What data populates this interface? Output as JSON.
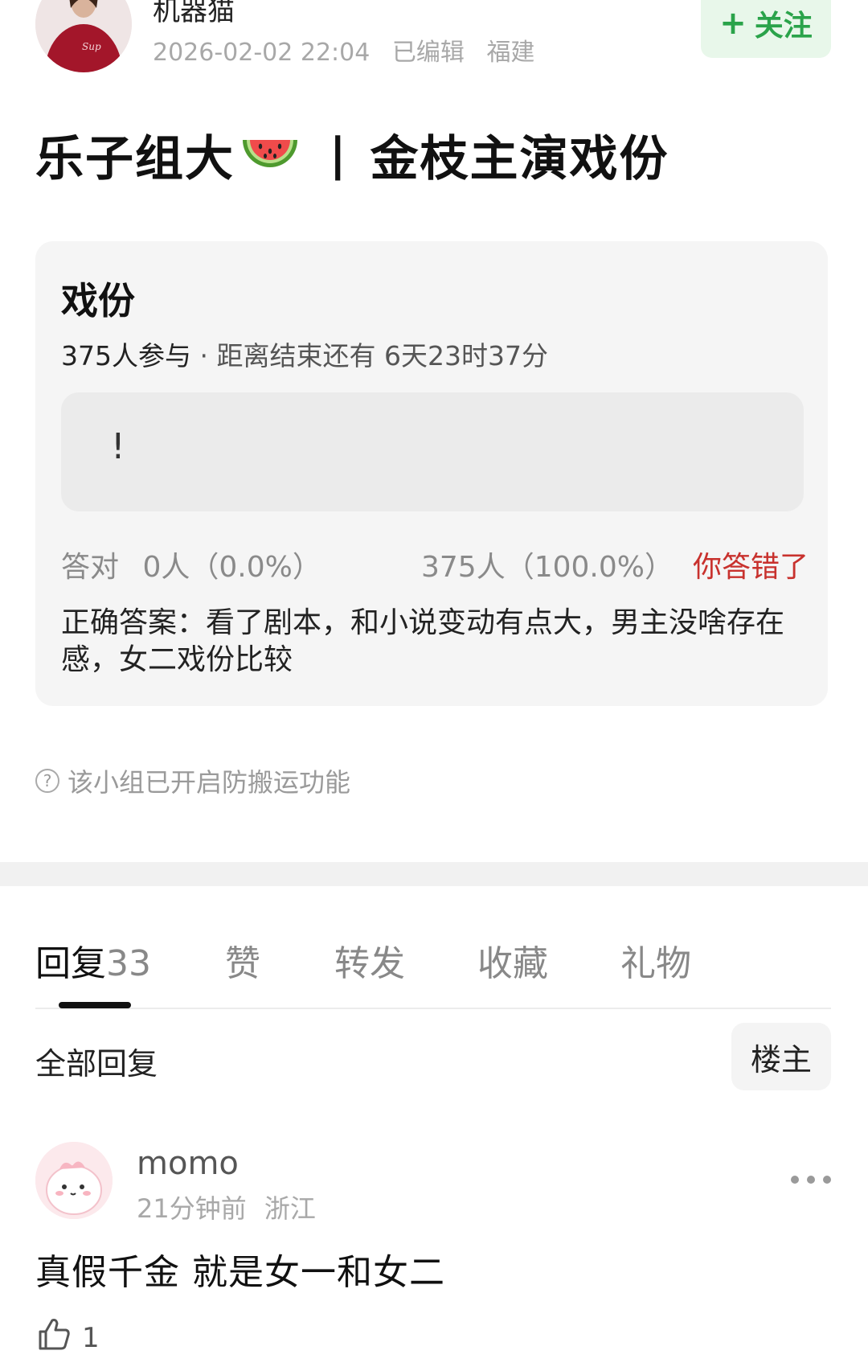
{
  "post": {
    "author": "机器猫",
    "date": "2026-02-02 22:04",
    "edited": "已编辑",
    "location": "福建",
    "follow_label": "关注",
    "title_part1": "乐子组大",
    "title_part2": "金枝主演戏份"
  },
  "quiz": {
    "title": "戏份",
    "participants": "375人参与",
    "separator": "·",
    "countdown": "距离结束还有 6天23时37分",
    "option_text": "!",
    "correct_label": "答对",
    "correct_count": "0人（0.0%）",
    "wrong_count": "375人（100.0%）",
    "user_result": "你答错了",
    "answer": "正确答案：看了剧本，和小说变动有点大，男主没啥存在感，女二戏份比较"
  },
  "notice": {
    "text": "该小组已开启防搬运功能"
  },
  "tabs": [
    {
      "label": "回复",
      "count": "33"
    },
    {
      "label": "赞",
      "count": ""
    },
    {
      "label": "转发",
      "count": ""
    },
    {
      "label": "收藏",
      "count": ""
    },
    {
      "label": "礼物",
      "count": ""
    }
  ],
  "filter": {
    "all_label": "全部回复",
    "op_label": "楼主"
  },
  "comment": {
    "name": "momo",
    "time": "21分钟前",
    "location": "浙江",
    "text": "真假千金 就是女一和女二",
    "likes": "1"
  },
  "colors": {
    "accent_green": "#2aa34a",
    "wrong_red": "#c8312d",
    "card_bg": "#f5f5f5"
  },
  "icons": [
    "avatar",
    "watermelon-icon",
    "plus-icon",
    "help-icon",
    "more-icon",
    "thumbs-up-icon"
  ]
}
